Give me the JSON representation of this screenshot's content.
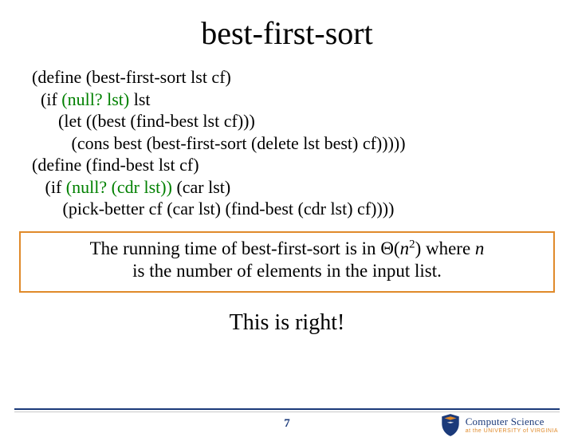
{
  "title": "best-first-sort",
  "code": {
    "l1a": "(define (best-first-sort lst cf)",
    "l2a": "  (if ",
    "l2b": "(null? lst)",
    "l2c": " lst",
    "l3": "      (let ((best (find-best lst cf)))",
    "l4": "         (cons best (best-first-sort (delete lst best) cf)))))",
    "l5": "(define (find-best lst cf)",
    "l6a": "   (if ",
    "l6b": "(null? (cdr lst))",
    "l6c": " (car lst)",
    "l7": "       (pick-better cf (car lst) (find-best (cdr lst) cf))))"
  },
  "running": {
    "line1_pre": "The running time of best-first-sort is in ",
    "theta_open": "Θ(",
    "nvar": "n",
    "exp": "2",
    "theta_close": ")",
    "line1_post": " where ",
    "n_trailing": "n",
    "line2": "is the number of elements in the input list."
  },
  "right_msg": "This is right!",
  "page_num": "7",
  "logo": {
    "cs": "Computer Science",
    "uva_pre": "at the ",
    "uva_main": "UNIVERSITY of VIRGINIA"
  }
}
